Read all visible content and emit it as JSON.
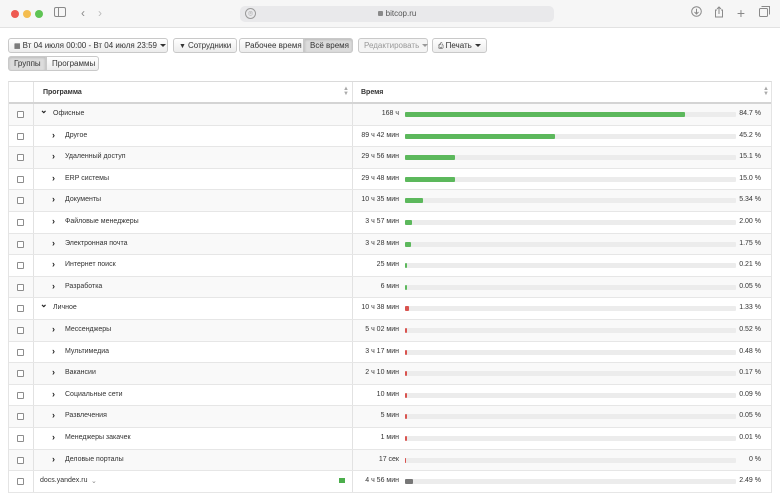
{
  "browser": {
    "url": "bitcop.ru",
    "icons": [
      "sidebar-icon",
      "back-icon",
      "forward-icon",
      "download-icon",
      "share-icon",
      "new-tab-icon",
      "tabs-icon"
    ]
  },
  "toolbar": {
    "date_range": "Вт 04 июля 00:00 - Вт 04 июля 23:59",
    "employees": "Сотрудники",
    "work_time": "Рабочее время",
    "all_time": "Всё время",
    "edit": "Редактировать",
    "print": "Печать"
  },
  "tabs": {
    "groups": "Группы",
    "programs": "Программы"
  },
  "table": {
    "col_program": "Программа",
    "col_time": "Время",
    "rows": [
      {
        "label": "Офисные",
        "time": "168 ч",
        "pct": "84.7 %",
        "value": 84.7,
        "level": 0,
        "expanded": true,
        "color": "#5cb85c"
      },
      {
        "label": "Другое",
        "time": "89 ч 42 мин",
        "pct": "45.2 %",
        "value": 45.2,
        "level": 1,
        "expanded": false,
        "color": "#5cb85c"
      },
      {
        "label": "Удаленный доступ",
        "time": "29 ч 56 мин",
        "pct": "15.1 %",
        "value": 15.1,
        "level": 1,
        "expanded": false,
        "color": "#5cb85c"
      },
      {
        "label": "ERP системы",
        "time": "29 ч 48 мин",
        "pct": "15.0 %",
        "value": 15.0,
        "level": 1,
        "expanded": false,
        "color": "#5cb85c"
      },
      {
        "label": "Документы",
        "time": "10 ч 35 мин",
        "pct": "5.34 %",
        "value": 5.34,
        "level": 1,
        "expanded": false,
        "color": "#5cb85c"
      },
      {
        "label": "Файловые менеджеры",
        "time": "3 ч 57 мин",
        "pct": "2.00 %",
        "value": 2.0,
        "level": 1,
        "expanded": false,
        "color": "#5cb85c"
      },
      {
        "label": "Электронная почта",
        "time": "3 ч 28 мин",
        "pct": "1.75 %",
        "value": 1.75,
        "level": 1,
        "expanded": false,
        "color": "#5cb85c"
      },
      {
        "label": "Интернет поиск",
        "time": "25 мин",
        "pct": "0.21 %",
        "value": 0.21,
        "level": 1,
        "expanded": false,
        "color": "#5cb85c"
      },
      {
        "label": "Разработка",
        "time": "6 мин",
        "pct": "0.05 %",
        "value": 0.05,
        "level": 1,
        "expanded": false,
        "color": "#5cb85c"
      },
      {
        "label": "Личное",
        "time": "10 ч 38 мин",
        "pct": "1.33 %",
        "value": 1.33,
        "level": 0,
        "expanded": true,
        "color": "#d9534f"
      },
      {
        "label": "Мессенджеры",
        "time": "5 ч 02 мин",
        "pct": "0.52 %",
        "value": 0.52,
        "level": 1,
        "expanded": false,
        "color": "#d9534f"
      },
      {
        "label": "Мультимедиа",
        "time": "3 ч 17 мин",
        "pct": "0.48 %",
        "value": 0.48,
        "level": 1,
        "expanded": false,
        "color": "#d9534f"
      },
      {
        "label": "Вакансии",
        "time": "2 ч 10 мин",
        "pct": "0.17 %",
        "value": 0.17,
        "level": 1,
        "expanded": false,
        "color": "#d9534f"
      },
      {
        "label": "Социальные сети",
        "time": "10 мин",
        "pct": "0.09 %",
        "value": 0.09,
        "level": 1,
        "expanded": false,
        "color": "#d9534f"
      },
      {
        "label": "Развлечения",
        "time": "5 мин",
        "pct": "0.05 %",
        "value": 0.05,
        "level": 1,
        "expanded": false,
        "color": "#d9534f"
      },
      {
        "label": "Менеджеры закачек",
        "time": "1 мин",
        "pct": "0.01 %",
        "value": 0.01,
        "level": 1,
        "expanded": false,
        "color": "#d9534f"
      },
      {
        "label": "Деловые порталы",
        "time": "17 сек",
        "pct": "0 %",
        "value": 0,
        "level": 1,
        "expanded": false,
        "color": "#d9534f"
      },
      {
        "label": "docs.yandex.ru",
        "time": "4 ч 56 мин",
        "pct": "2.49 %",
        "value": 2.49,
        "level": -1,
        "expanded": false,
        "color": "#777777"
      }
    ]
  }
}
